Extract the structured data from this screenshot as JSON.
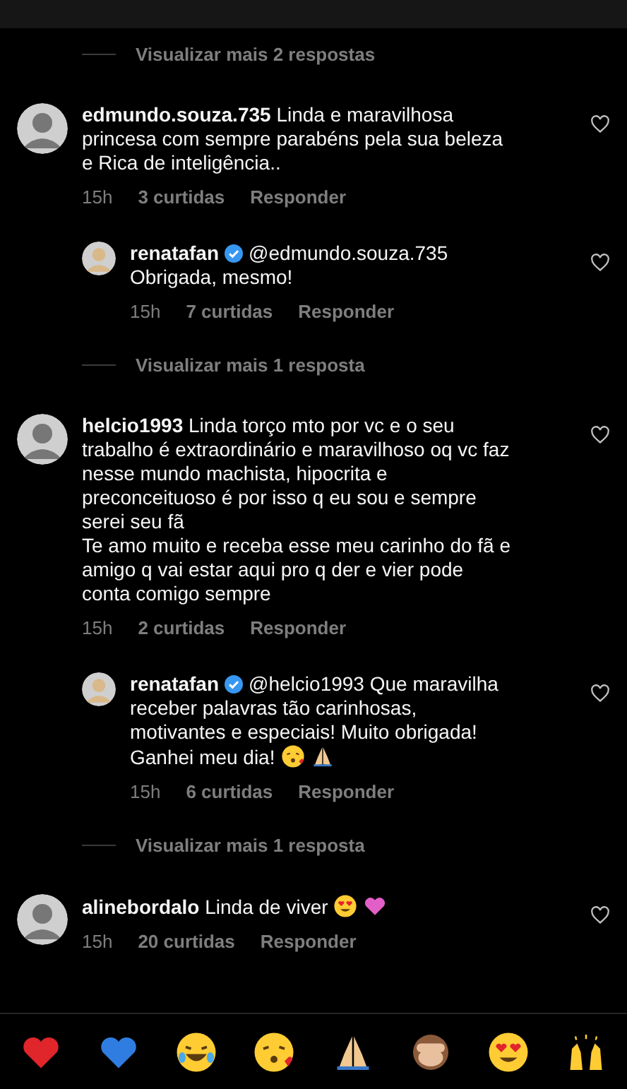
{
  "threads": [
    {
      "more_replies": "Visualizar mais 2 respostas",
      "comment": {
        "username": "edmundo.souza.735",
        "verified": false,
        "text": "Linda e maravilhosa princesa com sempre parabéns pela sua beleza e Rica de inteligência..",
        "time": "15h",
        "likes": "3 curtidas",
        "reply": "Responder",
        "liked": false
      },
      "replies": [
        {
          "username": "renatafan",
          "verified": true,
          "text": "@edmundo.souza.735 Obrigada, mesmo!",
          "time": "15h",
          "likes": "7 curtidas",
          "reply": "Responder",
          "liked": false
        }
      ]
    },
    {
      "more_replies": "Visualizar mais 1 resposta",
      "comment": {
        "username": "helcio1993",
        "verified": false,
        "text": "Linda torço mto por vc e o seu trabalho é extraordinário e maravilhoso oq vc faz nesse mundo machista, hipocrita e preconceituoso é por isso q eu sou e sempre serei seu fã\nTe amo muito e receba esse meu carinho do fã e amigo q vai estar aqui pro q der e vier pode conta comigo sempre",
        "time": "15h",
        "likes": "2 curtidas",
        "reply": "Responder",
        "liked": false
      },
      "replies": [
        {
          "username": "renatafan",
          "verified": true,
          "text": "@helcio1993 Que maravilha receber palavras tão carinhosas, motivantes e especiais! Muito obrigada! Ganhei meu dia!",
          "emoji": [
            {
              "kind": "kiss"
            },
            {
              "kind": "pray"
            }
          ],
          "time": "15h",
          "likes": "6 curtidas",
          "reply": "Responder",
          "liked": false
        }
      ]
    },
    {
      "more_replies": "Visualizar mais 1 resposta",
      "comment": {
        "username": "alinebordalo",
        "verified": false,
        "text": "Linda de viver",
        "emoji": [
          {
            "kind": "hearteyes"
          },
          {
            "kind": "pinkheart"
          }
        ],
        "time": "15h",
        "likes": "20 curtidas",
        "reply": "Responder",
        "liked": false
      }
    }
  ],
  "reactions": [
    {
      "kind": "redheart"
    },
    {
      "kind": "blueheart"
    },
    {
      "kind": "laugh"
    },
    {
      "kind": "kiss"
    },
    {
      "kind": "pray"
    },
    {
      "kind": "monkey"
    },
    {
      "kind": "hearteyes"
    },
    {
      "kind": "raised"
    }
  ]
}
